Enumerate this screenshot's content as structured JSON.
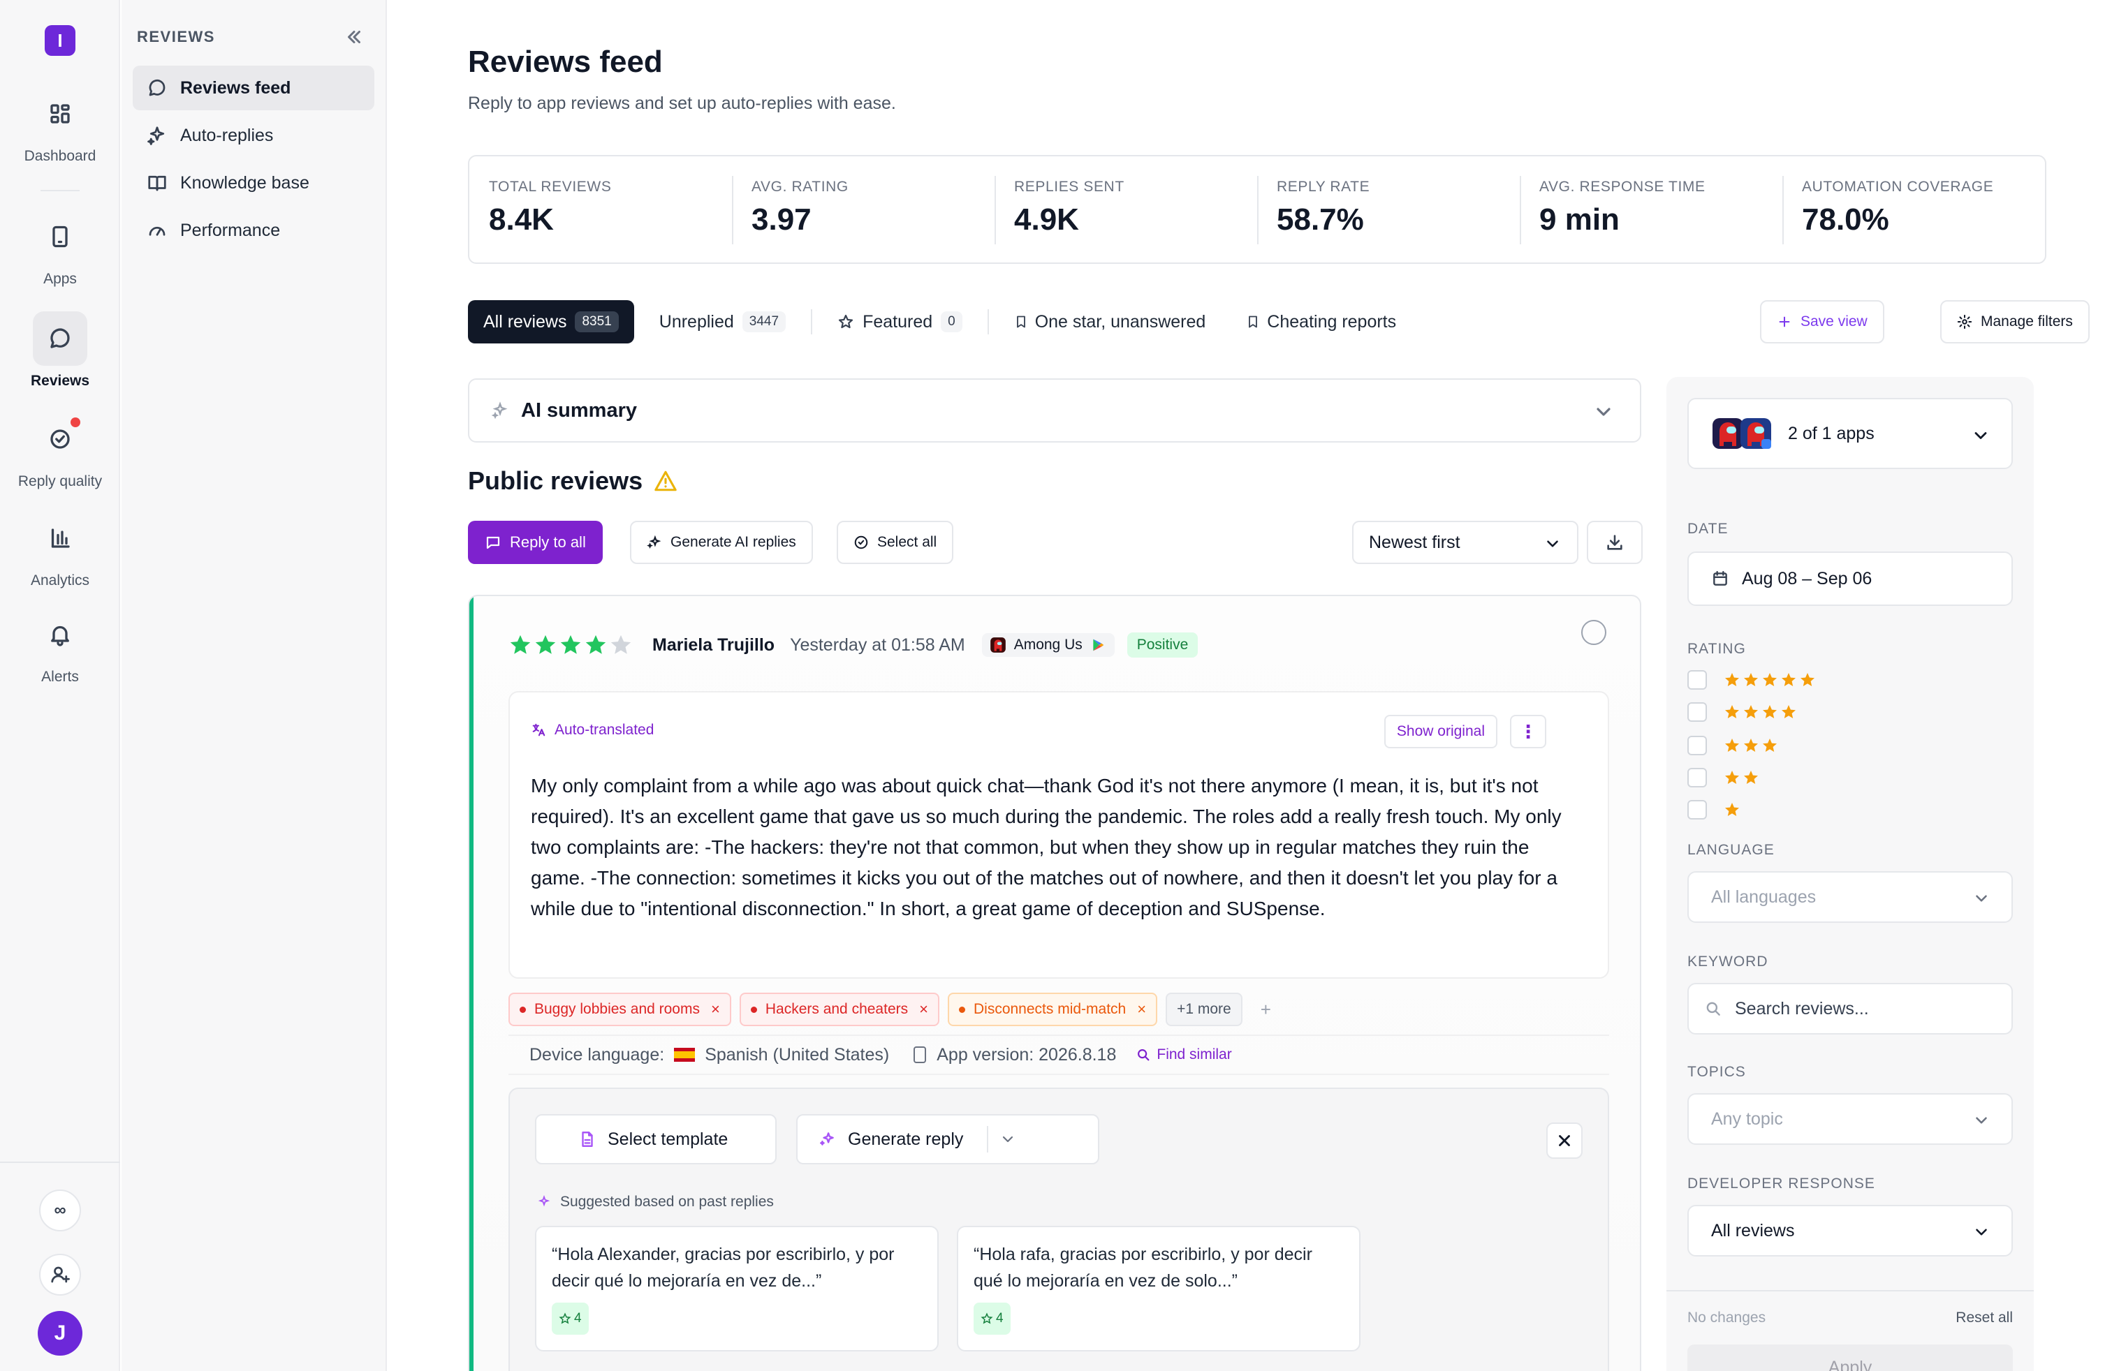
{
  "brand": {
    "logo_letter": "I"
  },
  "rail": {
    "items": [
      {
        "label": "Dashboard",
        "icon": "dashboard-icon"
      },
      {
        "label": "Apps",
        "icon": "phone-icon"
      },
      {
        "label": "Reviews",
        "icon": "chat-icon",
        "active": true
      },
      {
        "label": "Reply quality",
        "icon": "check-circle-icon",
        "notification": true
      },
      {
        "label": "Analytics",
        "icon": "bar-chart-icon"
      },
      {
        "label": "Alerts",
        "icon": "bell-icon"
      }
    ],
    "bottom": {
      "infinity": "∞",
      "avatar_initial": "J"
    }
  },
  "sidebar": {
    "heading": "REVIEWS",
    "items": [
      {
        "label": "Reviews feed",
        "icon": "chat-icon",
        "active": true
      },
      {
        "label": "Auto-replies",
        "icon": "sparkle-icon"
      },
      {
        "label": "Knowledge base",
        "icon": "book-icon"
      },
      {
        "label": "Performance",
        "icon": "gauge-icon"
      }
    ]
  },
  "page": {
    "title": "Reviews feed",
    "subtitle": "Reply to app reviews and set up auto-replies with ease."
  },
  "stats": [
    {
      "label": "TOTAL REVIEWS",
      "value": "8.4K"
    },
    {
      "label": "AVG. RATING",
      "value": "3.97"
    },
    {
      "label": "REPLIES SENT",
      "value": "4.9K"
    },
    {
      "label": "REPLY RATE",
      "value": "58.7%"
    },
    {
      "label": "AVG. RESPONSE TIME",
      "value": "9 min"
    },
    {
      "label": "AUTOMATION COVERAGE",
      "value": "78.0%"
    }
  ],
  "tabs": [
    {
      "label": "All reviews",
      "count": "8351",
      "active": true
    },
    {
      "label": "Unreplied",
      "count": "3447"
    },
    {
      "label": "Featured",
      "count": "0",
      "icon": "star-outline-icon"
    },
    {
      "label": "One star, unanswered",
      "icon": "bookmark-icon"
    },
    {
      "label": "Cheating reports",
      "icon": "bookmark-icon"
    }
  ],
  "view_actions": {
    "save_view": "Save view",
    "manage_filters": "Manage filters"
  },
  "ai_summary": {
    "label": "AI summary"
  },
  "public_reviews": {
    "title": "Public reviews",
    "reply_all": "Reply to all",
    "generate_ai": "Generate AI replies",
    "select_all": "Select all",
    "sort": "Newest first"
  },
  "review": {
    "rating": 4,
    "author": "Mariela Trujillo",
    "time": "Yesterday at 01:58 AM",
    "app": "Among Us",
    "sentiment": "Positive",
    "translated_label": "Auto-translated",
    "show_original": "Show original",
    "text": "My only complaint from a while ago was about quick chat—thank God it's not there anymore (I mean, it is, but it's not required). It's an excellent game that gave us so much during the pandemic. The roles add a really fresh touch. My only two complaints are: -The hackers: they're not that common, but when they show up in regular matches they ruin the game. -The connection: sometimes it kicks you out of the matches out of nowhere, and then it doesn't let you play for a while due to \"intentional disconnection.\" In short, a great game of deception and SUSpense.",
    "tags": [
      {
        "label": "Buggy lobbies and rooms",
        "color": "red"
      },
      {
        "label": "Hackers and cheaters",
        "color": "red"
      },
      {
        "label": "Disconnects mid-match",
        "color": "orange"
      }
    ],
    "more_tags": "+1 more",
    "add_tag": "+",
    "device_language_label": "Device language:",
    "device_language": "Spanish (United States)",
    "app_version": "App version: 2026.8.18",
    "find_similar": "Find similar"
  },
  "reply_panel": {
    "select_template": "Select template",
    "generate_reply": "Generate reply",
    "suggested_label": "Suggested based on past replies",
    "suggestions": [
      {
        "text": "“Hola Alexander, gracias por escribirlo, y por decir qué lo mejoraría en vez de...”",
        "count": "4"
      },
      {
        "text": "“Hola rafa, gracias por escribirlo, y por decir qué lo mejoraría en vez de solo...”",
        "count": "4"
      }
    ]
  },
  "filters": {
    "app_select": "2 of 1 apps",
    "date_label": "DATE",
    "date_value": "Aug 08 – Sep 06",
    "rating_label": "RATING",
    "rating_options": [
      5,
      4,
      3,
      2,
      1
    ],
    "language_label": "LANGUAGE",
    "language_value": "All languages",
    "keyword_label": "KEYWORD",
    "keyword_placeholder": "Search reviews...",
    "topics_label": "TOPICS",
    "topics_value": "Any topic",
    "developer_response_label": "DEVELOPER RESPONSE",
    "developer_response_value": "All reviews",
    "no_changes": "No changes",
    "reset_all": "Reset all",
    "apply": "Apply"
  },
  "colors": {
    "accent": "#7e22ce",
    "star_green": "#22c55e",
    "star_amber": "#f59e0b",
    "positive_bg": "#dcfce7"
  }
}
